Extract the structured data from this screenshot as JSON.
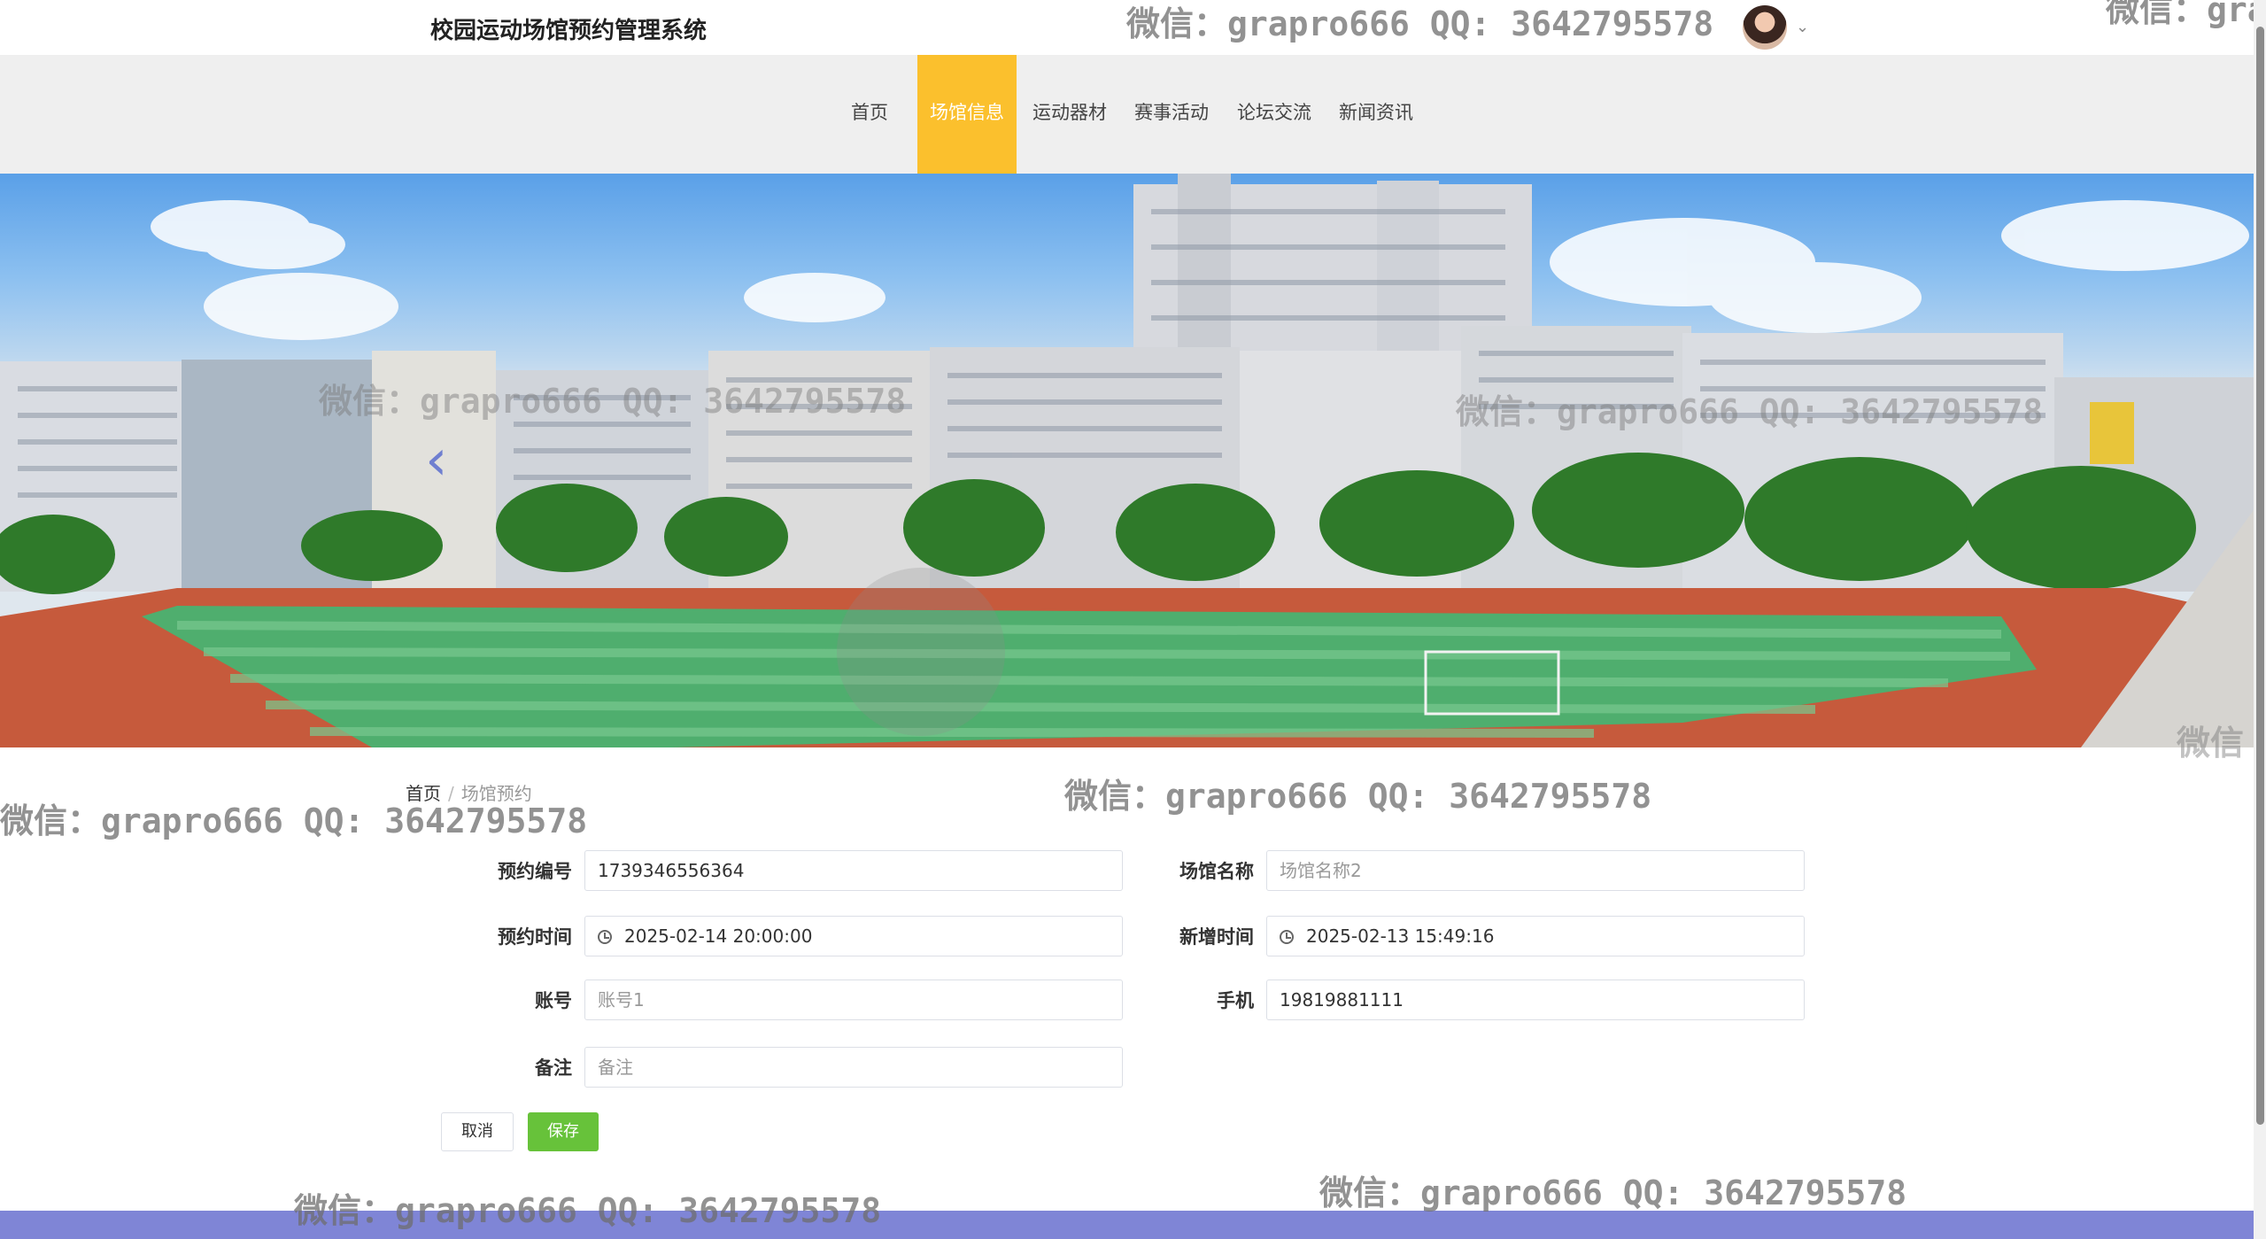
{
  "header": {
    "site_title": "校园运动场馆预约管理系统"
  },
  "nav": {
    "items": [
      "首页",
      "场馆信息",
      "运动器材",
      "赛事活动",
      "论坛交流",
      "新闻资讯"
    ],
    "active": "场馆信息"
  },
  "banner": {
    "prev_icon": "‹"
  },
  "breadcrumb": {
    "home": "首页",
    "separator": "/",
    "current": "场馆预约"
  },
  "form": {
    "reservation_no": {
      "label": "预约编号",
      "value": "1739346556364"
    },
    "venue_name": {
      "label": "场馆名称",
      "placeholder": "场馆名称2"
    },
    "reservation_time": {
      "label": "预约时间",
      "value": "2025-02-14 20:00:00"
    },
    "created_time": {
      "label": "新增时间",
      "value": "2025-02-13 15:49:16"
    },
    "account": {
      "label": "账号",
      "placeholder": "账号1"
    },
    "phone": {
      "label": "手机",
      "value": "19819881111"
    },
    "remark": {
      "label": "备注",
      "placeholder": "备注"
    },
    "cancel_label": "取消",
    "save_label": "保存"
  },
  "watermark": {
    "text": "微信：grapro666 QQ: 3642795578",
    "partial_right": "微信：gra",
    "partial_small": "微信"
  },
  "colors": {
    "nav_active": "#fbc02d",
    "save_button": "#67c23a",
    "footer": "#7f85d6"
  }
}
